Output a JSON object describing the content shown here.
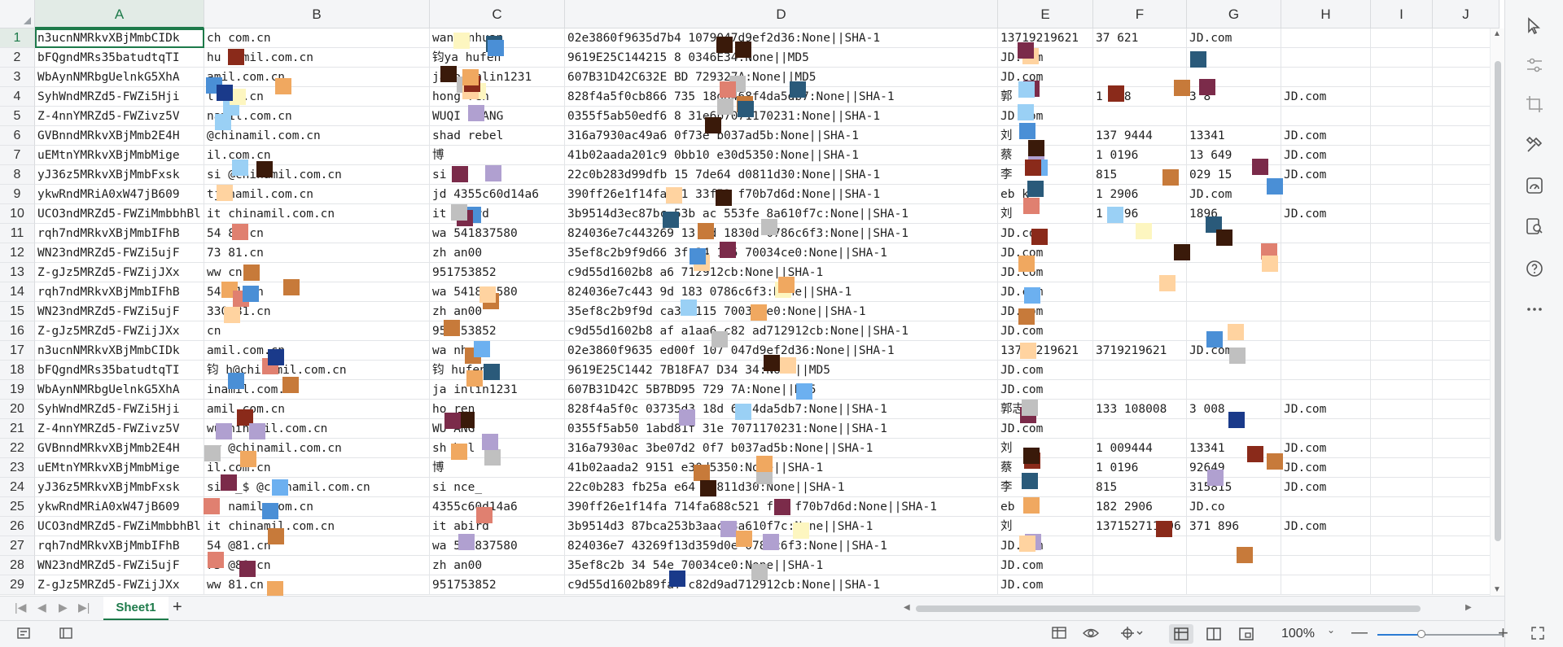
{
  "sheet": {
    "columns": [
      {
        "label": "A",
        "w": 208
      },
      {
        "label": "B",
        "w": 277
      },
      {
        "label": "C",
        "w": 166
      },
      {
        "label": "D",
        "w": 532
      },
      {
        "label": "E",
        "w": 117
      },
      {
        "label": "F",
        "w": 115
      },
      {
        "label": "G",
        "w": 116
      },
      {
        "label": "H",
        "w": 110
      },
      {
        "label": "I",
        "w": 76
      },
      {
        "label": "J",
        "w": 82
      }
    ],
    "selected_column": "A",
    "selected_row": 1,
    "rows": [
      {
        "n": 1,
        "A": "n3ucnNMRkvXBjMmbCIDk",
        "B": "   ch      com.cn",
        "C": "wang  nhuan",
        "D": "02e3860f9635d7b4       1079047d9ef2d36:None||SHA-1",
        "E": "13719219621",
        "F": "37      621",
        "G": "JD.com"
      },
      {
        "n": 2,
        "A": "bFQgndMRs35batudtqTI",
        "B": "   hu      namil.com.cn",
        "C": "钧ya  hufen",
        "D": "9619E25C144215     8    0346E34:None||MD5",
        "E": "JD.com"
      },
      {
        "n": 3,
        "A": "WbAynNMRbgUelnkG5XhA",
        "B": "         amil.com.cn",
        "C": "jaso  inlin1231",
        "D": "607B31D42C632E    BD    729327A:None||MD5",
        "E": "JD.com"
      },
      {
        "n": 4,
        "A": "SyhWndMRZd5-FWZi5Hji",
        "B": "          l.com.cn",
        "C": "hong   ren",
        "D": "828f4a5f0cb866      735    18dd468f4da5db7:None||SHA-1",
        "E": "郭",
        "F": "1       008",
        "G": "3           8",
        "H": "JD.com"
      },
      {
        "n": 5,
        "A": "Z-4nnYMRZd5-FWZivz5V",
        "B": "        namil.com.cn",
        "C": "WUQI  HUANG",
        "D": "0355f5ab50edf6     8   31e6b7071170231:None||SHA-1",
        "E": "JD.com"
      },
      {
        "n": 6,
        "A": "GVBnndMRkvXBjMmb2E4H",
        "B": "          @chinamil.com.cn",
        "C": "shad  rebel",
        "D": "316a7930ac49a6       0f73e   b037ad5b:None||SHA-1",
        "E": "刘",
        "F": "137    9444",
        "G": "     13341",
        "H": "JD.com"
      },
      {
        "n": 7,
        "A": "uEMtnYMRkvXBjMmbMige",
        "B": "         il.com.cn",
        "C": "博",
        "D": "41b02aada201c9       0bb10   e30d5350:None||SHA-1",
        "E": "蔡",
        "F": "1      0196",
        "G": "13     649",
        "H": "JD.com"
      },
      {
        "n": 8,
        "A": "yJ36z5MRkvXBjMmbFxsk",
        "B": "si         @chinamil.com.cn",
        "C": "si   e_",
        "D": "22c0b283d99dfb      15  7de64   d0811d30:None||SHA-1",
        "E": "李",
        "F": "       815",
        "G": "029    15",
        "H": "JD.com"
      },
      {
        "n": 9,
        "A": "ykwRndMRiA0xW47jB609",
        "B": "tj          namil.com.cn",
        "C": "jd  4355c60d14a6",
        "D": "390ff26e1f14fa      71  33f52   f70b7d6d:None||SHA-1",
        "E": "eb  k",
        "F": "1      2906",
        "G": "JD.com"
      },
      {
        "n": 10,
        "A": "UCO3ndMRZd5-FWZiMmbbhBl",
        "B": "it         chinamil.com.cn",
        "C": "it  abird",
        "D": "3b9514d3ec87bc   53b  ac   553fe   8a610f7c:None||SHA-1",
        "E": "刘",
        "F": "1      1896",
        "G": "       1896",
        "H": "JD.com"
      },
      {
        "n": 11,
        "A": "rqh7ndMRkvXBjMmbIFhB",
        "B": "54        81.cn",
        "C": "wa  541837580",
        "D": "824036e7c443269  13   9d  1830d   0786c6f3:None||SHA-1",
        "E": "JD.com"
      },
      {
        "n": 12,
        "A": "WN23ndMRZd5-FWZi5ujF",
        "B": "73        81.cn",
        "C": "zh  an00",
        "D": "35ef8c2b9f9d66   3f    34  115    70034ce0:None||SHA-1",
        "E": "JD.com"
      },
      {
        "n": 13,
        "A": "Z-gJz5MRZd5-FWZijJXx",
        "B": "ww         cn",
        "C": "       951753852",
        "D": "c9d55d1602b8          a6     712912cb:None||SHA-1",
        "E": "JD.com"
      },
      {
        "n": 14,
        "A": "rqh7ndMRkvXBjMmbIFhB",
        "B": "54        81.cn",
        "C": "wa  541837580",
        "D": "824036e7c443       9d  183    0786c6f3:None||SHA-1",
        "E": "JD.com"
      },
      {
        "n": 15,
        "A": "WN23ndMRZd5-FWZi5ujF",
        "B": "     330 81.cn",
        "C": "zh  an00",
        "D": "35ef8c2b9f9d        ca34  115    70034ce0:None||SHA-1",
        "E": "JD.com"
      },
      {
        "n": 16,
        "A": "Z-gJz5MRZd5-FWZijJXx",
        "B": "          cn",
        "C": "       951753852",
        "D": "c9d55d1602b8  af  a1aa6  c82  ad712912cb:None||SHA-1",
        "E": "JD.com"
      },
      {
        "n": 17,
        "A": "n3ucnNMRkvXBjMmbCIDk",
        "B": "         amil.com.cn",
        "C": "wa  nhuan",
        "D": "02e3860f9635      ed00f  107  047d9ef2d36:None||SHA-1",
        "E": "13719219621",
        "F": "3719219621",
        "G": "JD.com"
      },
      {
        "n": 18,
        "A": "bFQgndMRs35batudtqTI",
        "B": "钧       h@chinamil.com.cn",
        "C": "钧   hufen",
        "D": "9619E25C1442   7B18FA7  D34   34:None||MD5",
        "E": "JD.com"
      },
      {
        "n": 19,
        "A": "WbAynNMRbgUelnkG5XhA",
        "B": "         inamil.com.cn",
        "C": "ja  inlin1231",
        "D": "607B31D42C      5B7BD95  729  7A:None||MD5",
        "E": "JD.com"
      },
      {
        "n": 20,
        "A": "SyhWndMRZd5-FWZi5Hji",
        "B": "         amil.com.cn",
        "C": "ho   ren",
        "D": "828f4a5f0c       03735d3  18d  68f4da5db7:None||SHA-1",
        "E": "郭志宏",
        "F": "133   108008",
        "G": "3      008",
        "H": "JD.com"
      },
      {
        "n": 21,
        "A": "Z-4nnYMRZd5-FWZivz5V",
        "B": "wu      hinamil.com.cn",
        "C": "WU   ANG",
        "D": "0355f5ab50      1abd81f  31e  7071170231:None||SHA-1",
        "E": "JD.com"
      },
      {
        "n": 22,
        "A": "GVBnndMRkvXBjMmb2E4H",
        "B": "ow      @chinamil.com.cn",
        "C": "sh   bel",
        "D": "316a7930ac      3be07d2  0f7  b037ad5b:None||SHA-1",
        "E": "刘",
        "F": "1    009444",
        "G": "      13341",
        "H": "JD.com"
      },
      {
        "n": 23,
        "A": "uEMtnYMRkvXBjMmbMige",
        "B": "         il.com.cn",
        "C": "博",
        "D": "41b02aada2      9151    e30d5350:None||SHA-1",
        "E": "蔡",
        "F": "1      0196",
        "G": "      92649",
        "H": "JD.com"
      },
      {
        "n": 24,
        "A": "yJ36z5MRkvXBjMmbFxsk",
        "B": "si    e_$  @chinamil.com.cn",
        "C": "si   nce_",
        "D": "22c0b283    fb25a     e64  d0811d30:None||SHA-1",
        "E": "李",
        "F": "       815",
        "G": "     315815",
        "H": "JD.com"
      },
      {
        "n": 25,
        "A": "ykwRndMRiA0xW47jB609",
        "B": "tj         namil.com.cn",
        "C": "4355c60d14a6",
        "D": "390ff26e1f14fa  714fa688c521     f52  f70b7d6d:None||SHA-1",
        "E": "eb",
        "F": "182   2906",
        "G": "JD.co"
      },
      {
        "n": 26,
        "A": "UCO3ndMRZd5-FWZiMmbbhBl",
        "B": "it         chinamil.com.cn",
        "C": "it  abird",
        "D": "3b9514d3  87bca253b3aac    8a610f7c:None||SHA-1",
        "E": "刘",
        "F": "137152711896",
        "G": "371      896",
        "H": "JD.com"
      },
      {
        "n": 27,
        "A": "rqh7ndMRkvXBjMmbIFhB",
        "B": "54       @81.cn",
        "C": "wa  541837580",
        "D": "824036e7  43269f13d359d0e    0786c6f3:None||SHA-1",
        "E": "JD.com"
      },
      {
        "n": 28,
        "A": "WN23ndMRZd5-FWZi5ujF",
        "B": "73       @81.cn",
        "C": "zh  an00",
        "D": "35ef8c2b         34  54e  70034ce0:None||SHA-1",
        "E": "JD.com"
      },
      {
        "n": 29,
        "A": "Z-gJz5MRZd5-FWZijJXx",
        "B": "ww        81.cn",
        "C": "       951753852",
        "D": "c9d55d1602b89faf     c82d9ad712912cb:None||SHA-1",
        "E": "JD.com"
      }
    ]
  },
  "tabs": {
    "active": "Sheet1",
    "add_label": "+"
  },
  "status": {
    "zoom": "100%",
    "zoom_level": 0.35
  },
  "icons": {
    "right_panel": [
      "cursor-icon",
      "filter-settings-icon",
      "crop-icon",
      "tools-icon",
      "gauge-icon",
      "find-icon",
      "help-icon",
      "more-icon"
    ]
  },
  "colors": {
    "accent": "#1d7a4a",
    "grid_line": "#e3e5e8",
    "header_bg": "#f4f5f7",
    "zoom_fill": "#2b7bd3"
  }
}
